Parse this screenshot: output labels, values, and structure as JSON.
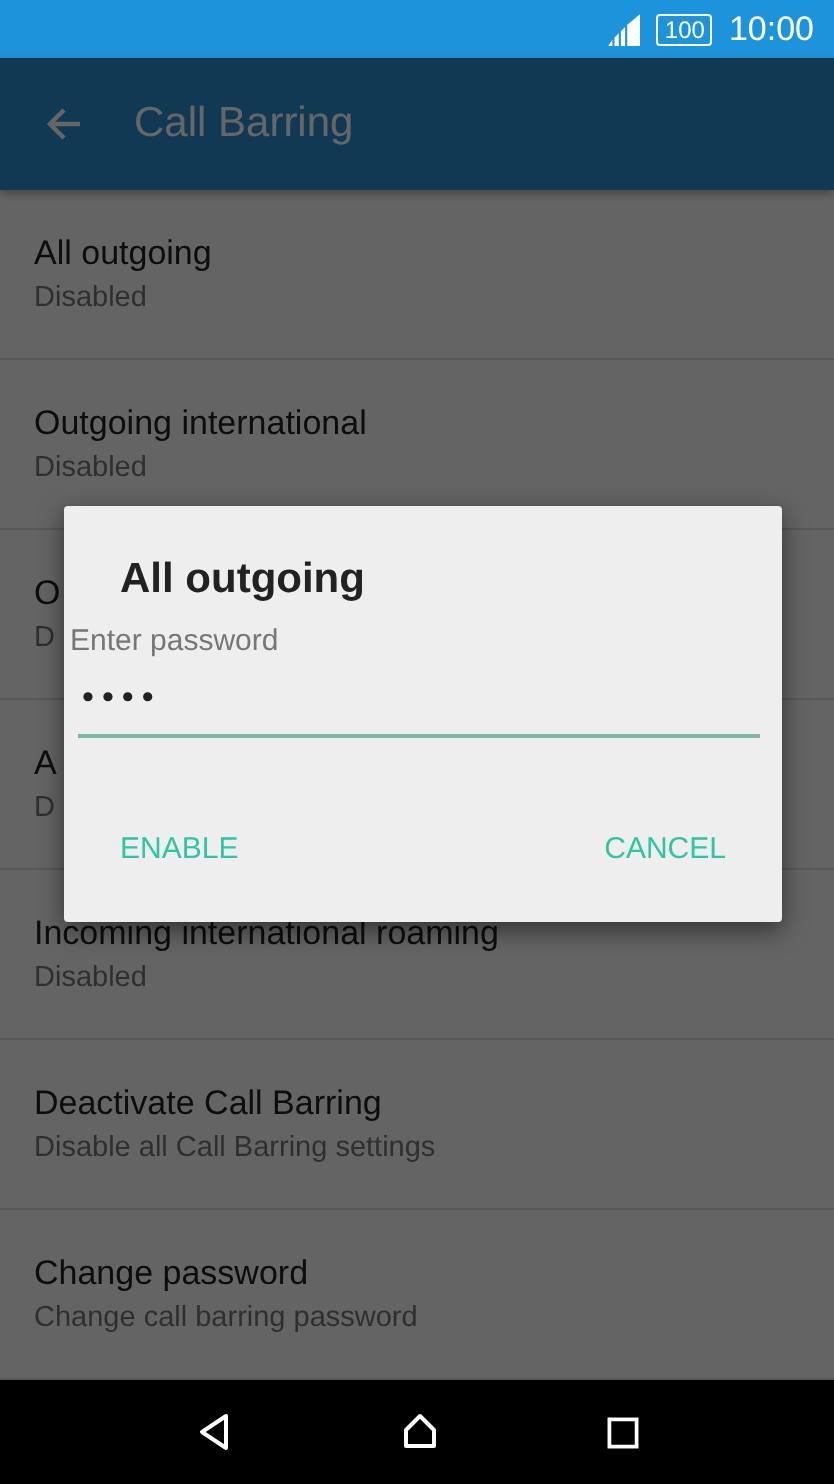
{
  "status_bar": {
    "battery": "100",
    "time": "10:00"
  },
  "app_bar": {
    "title": "Call Barring"
  },
  "items": [
    {
      "title": "All outgoing",
      "subtitle": "Disabled"
    },
    {
      "title": "Outgoing international",
      "subtitle": "Disabled"
    },
    {
      "title": "O",
      "subtitle": "D"
    },
    {
      "title": "A",
      "subtitle": "D"
    },
    {
      "title": "Incoming international roaming",
      "subtitle": "Disabled"
    },
    {
      "title": "Deactivate Call Barring",
      "subtitle": "Disable all Call Barring settings"
    },
    {
      "title": "Change password",
      "subtitle": "Change call barring password"
    }
  ],
  "dialog": {
    "title": "All outgoing",
    "label": "Enter password",
    "value": "••••",
    "buttons": [
      "ENABLE",
      "CANCEL"
    ]
  }
}
